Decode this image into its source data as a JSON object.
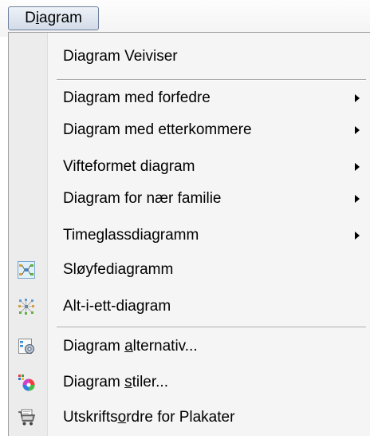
{
  "menubar": {
    "title_pre": "D",
    "title_acc": "i",
    "title_post": "agram"
  },
  "menu": {
    "items": [
      {
        "label": "Diagram Veiviser"
      },
      {
        "label": "Diagram med forfedre",
        "submenu": true
      },
      {
        "label": "Diagram med etterkommere",
        "submenu": true
      },
      {
        "label": "Vifteformet diagram",
        "submenu": true
      },
      {
        "label": "Diagram for nær familie",
        "submenu": true
      },
      {
        "label": "Timeglassdiagramm",
        "submenu": true
      },
      {
        "label": "Sløyfediagramm",
        "icon": "bowtie-chart-icon"
      },
      {
        "label": "Alt-i-ett-diagram",
        "icon": "all-in-one-chart-icon"
      },
      {
        "pre": "Diagram ",
        "acc": "a",
        "post": "lternativ...",
        "icon": "chart-options-icon"
      },
      {
        "pre": "Diagram ",
        "acc": "s",
        "post": "tiler...",
        "icon": "chart-styles-icon"
      },
      {
        "pre": "Utskrifts",
        "acc": "o",
        "post": "rdre for Plakater",
        "icon": "poster-print-order-icon"
      }
    ]
  }
}
